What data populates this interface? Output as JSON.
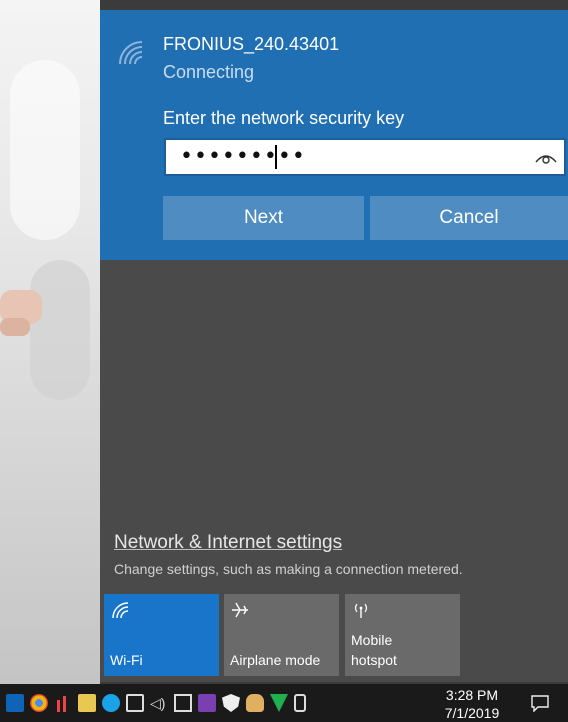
{
  "network": {
    "ssid": "FRONIUS_240.43401",
    "status": "Connecting",
    "key_label": "Enter the network security key",
    "key_value": "•••••••••",
    "next_label": "Next",
    "cancel_label": "Cancel"
  },
  "settings": {
    "link_label": "Network & Internet settings",
    "description": "Change settings, such as making a connection metered."
  },
  "quick_actions": [
    {
      "label": "Wi-Fi",
      "icon": "wifi-icon",
      "active": true
    },
    {
      "label": "Airplane mode",
      "icon": "airplane-icon",
      "active": false
    },
    {
      "label": "Mobile\nhotspot",
      "icon": "hotspot-icon",
      "active": false
    }
  ],
  "taskbar": {
    "time": "3:28 PM",
    "date": "7/1/2019",
    "tray_icons": [
      "outlook-icon",
      "chrome-icon",
      "flag-icon",
      "mail-icon",
      "skype-icon",
      "battery-icon",
      "volume-icon",
      "network-icon",
      "onenote-icon",
      "security-shield-icon",
      "hand-icon",
      "vpn-icon",
      "usb-icon"
    ]
  },
  "colors": {
    "accent": "#1f6fb2",
    "button": "#4f8cc2",
    "tile_active": "#1875c9",
    "tile": "#6a6a6a",
    "flyout_bg": "#4a4a4a"
  }
}
